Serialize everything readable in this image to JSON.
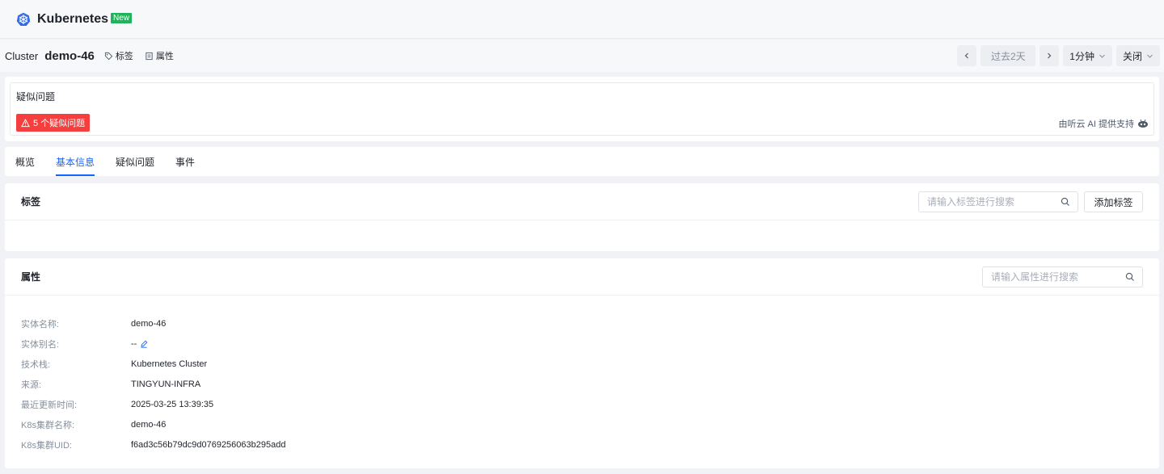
{
  "header": {
    "title": "Kubernetes",
    "badge": "New"
  },
  "breadcrumb": {
    "type": "Cluster",
    "name": "demo-46",
    "tags_link": "标签",
    "props_link": "属性"
  },
  "timecontrols": {
    "range": "过去2天",
    "interval": "1分钟",
    "refresh": "关闭"
  },
  "issues": {
    "title": "疑似问题",
    "badge": "5 个疑似问题",
    "ai_note": "由听云 AI 提供支持"
  },
  "tabs": [
    {
      "label": "概览"
    },
    {
      "label": "基本信息"
    },
    {
      "label": "疑似问题"
    },
    {
      "label": "事件"
    }
  ],
  "tags_section": {
    "title": "标签",
    "search_placeholder": "请输入标签进行搜索",
    "add_button": "添加标签"
  },
  "props_section": {
    "title": "属性",
    "search_placeholder": "请输入属性进行搜索",
    "rows": [
      {
        "label": "实体名称:",
        "value": "demo-46"
      },
      {
        "label": "实体别名:",
        "value": "--"
      },
      {
        "label": "技术栈:",
        "value": "Kubernetes Cluster"
      },
      {
        "label": "来源:",
        "value": "TINGYUN-INFRA"
      },
      {
        "label": "最近更新时间:",
        "value": "2025-03-25 13:39:35"
      },
      {
        "label": "K8s集群名称:",
        "value": "demo-46"
      },
      {
        "label": "K8s集群UID:",
        "value": "f6ad3c56b79dc9d0769256063b295add"
      }
    ]
  },
  "colors": {
    "accent": "#1664ff",
    "danger": "#f53f3f",
    "new_badge": "#21b35b"
  }
}
